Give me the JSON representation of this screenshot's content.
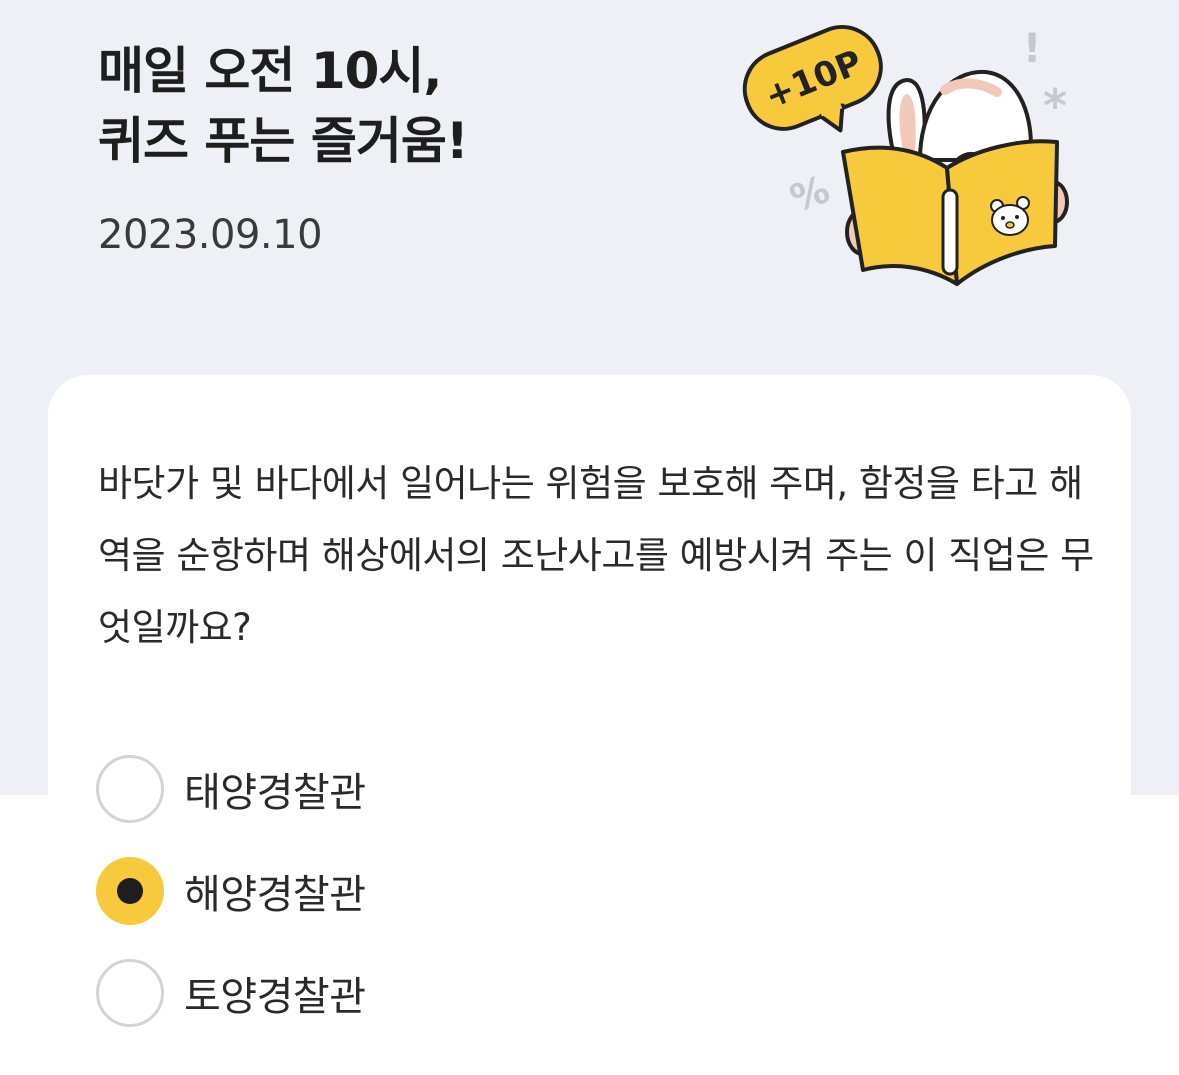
{
  "header": {
    "title_line1": "매일 오전 10시,",
    "title_line2": "퀴즈 푸는 즐거움!",
    "date": "2023.09.10",
    "badge": "+10P"
  },
  "illustration": {
    "icon": "rabbit-reading-book-icon",
    "decor": [
      "!",
      "*",
      "%"
    ]
  },
  "quiz": {
    "question": "바닷가 및 바다에서 일어나는 위험을 보호해 주며, 함정을 타고 해역을 순항하며 해상에서의 조난사고를 예방시켜 주는 이 직업은 무엇일까요?",
    "options": [
      {
        "label": "태양경찰관",
        "selected": false
      },
      {
        "label": "해양경찰관",
        "selected": true
      },
      {
        "label": "토양경찰관",
        "selected": false
      }
    ]
  },
  "colors": {
    "background": "#eff0f5",
    "accent": "#f7c93c",
    "card": "#ffffff"
  }
}
